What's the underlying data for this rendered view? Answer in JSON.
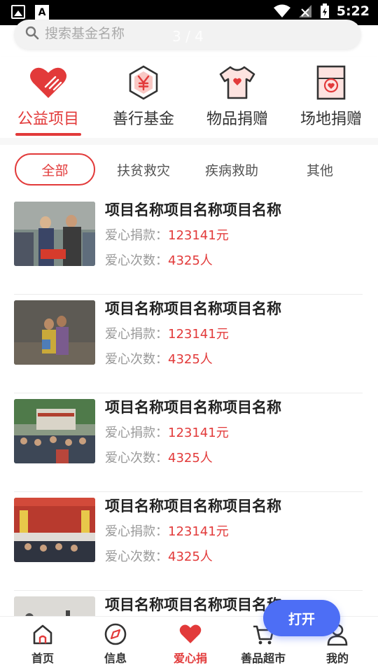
{
  "status_bar": {
    "time": "5:22",
    "icon_a": "A"
  },
  "search": {
    "placeholder": "搜索基金名称",
    "page_indicator": "3 / 4"
  },
  "categories": [
    {
      "label": "公益项目",
      "icon": "heart-icon"
    },
    {
      "label": "善行基金",
      "icon": "yen-hexagon-icon"
    },
    {
      "label": "物品捐赠",
      "icon": "tshirt-icon"
    },
    {
      "label": "场地捐赠",
      "icon": "venue-heart-icon"
    }
  ],
  "filters": [
    "全部",
    "扶贫救灾",
    "疾病救助",
    "其他"
  ],
  "items": [
    {
      "title": "项目名称项目名称项目名称",
      "donation_label": "爱心捐款：",
      "donation_value": "123141元",
      "count_label": "爱心次数：",
      "count_value": "4325人"
    },
    {
      "title": "项目名称项目名称项目名称",
      "donation_label": "爱心捐款：",
      "donation_value": "123141元",
      "count_label": "爱心次数：",
      "count_value": "4325人"
    },
    {
      "title": "项目名称项目名称项目名称",
      "donation_label": "爱心捐款：",
      "donation_value": "123141元",
      "count_label": "爱心次数：",
      "count_value": "4325人"
    },
    {
      "title": "项目名称项目名称项目名称",
      "donation_label": "爱心捐款：",
      "donation_value": "123141元",
      "count_label": "爱心次数：",
      "count_value": "4325人"
    },
    {
      "title": "项目名称项目名称项目名称"
    }
  ],
  "open_button": "打开",
  "tabs": [
    {
      "label": "首页",
      "icon": "home-icon"
    },
    {
      "label": "信息",
      "icon": "compass-icon"
    },
    {
      "label": "爱心捐",
      "icon": "heart-icon"
    },
    {
      "label": "善品超市",
      "icon": "cart-icon"
    },
    {
      "label": "我的",
      "icon": "user-icon"
    }
  ],
  "colors": {
    "accent": "#e23a3a",
    "open_button": "#4d6ef5"
  }
}
